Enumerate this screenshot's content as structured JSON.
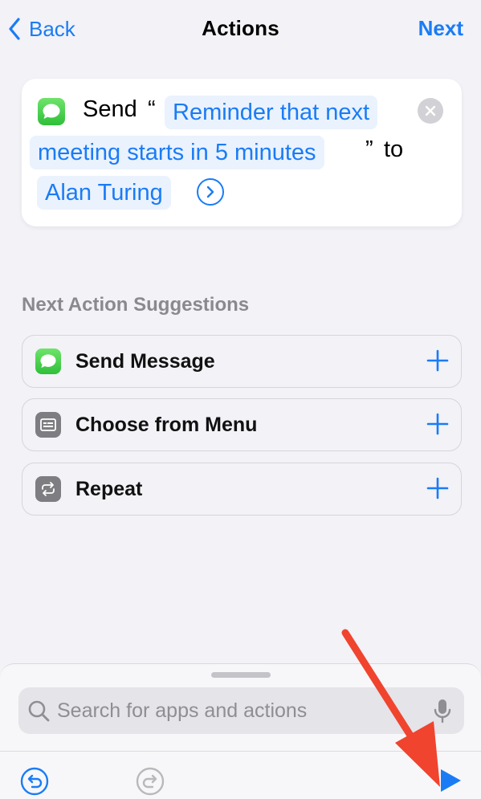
{
  "nav": {
    "back_label": "Back",
    "title": "Actions",
    "next_label": "Next"
  },
  "action": {
    "app_icon": "messages-icon",
    "send_word": "Send",
    "open_quote": "“",
    "message_line1": "Reminder that next",
    "message_line2": "meeting starts in 5 minutes",
    "close_quote": "”",
    "to_word": "to",
    "recipient": "Alan Turing"
  },
  "suggestions": {
    "header": "Next Action Suggestions",
    "items": [
      {
        "label": "Send Message",
        "icon": "messages-icon"
      },
      {
        "label": "Choose from Menu",
        "icon": "menu-icon"
      },
      {
        "label": "Repeat",
        "icon": "repeat-icon"
      }
    ]
  },
  "search": {
    "placeholder": "Search for apps and actions",
    "value": ""
  },
  "colors": {
    "accent": "#1a7cf5",
    "background": "#f2f2f7",
    "annotation": "#f0442f"
  }
}
